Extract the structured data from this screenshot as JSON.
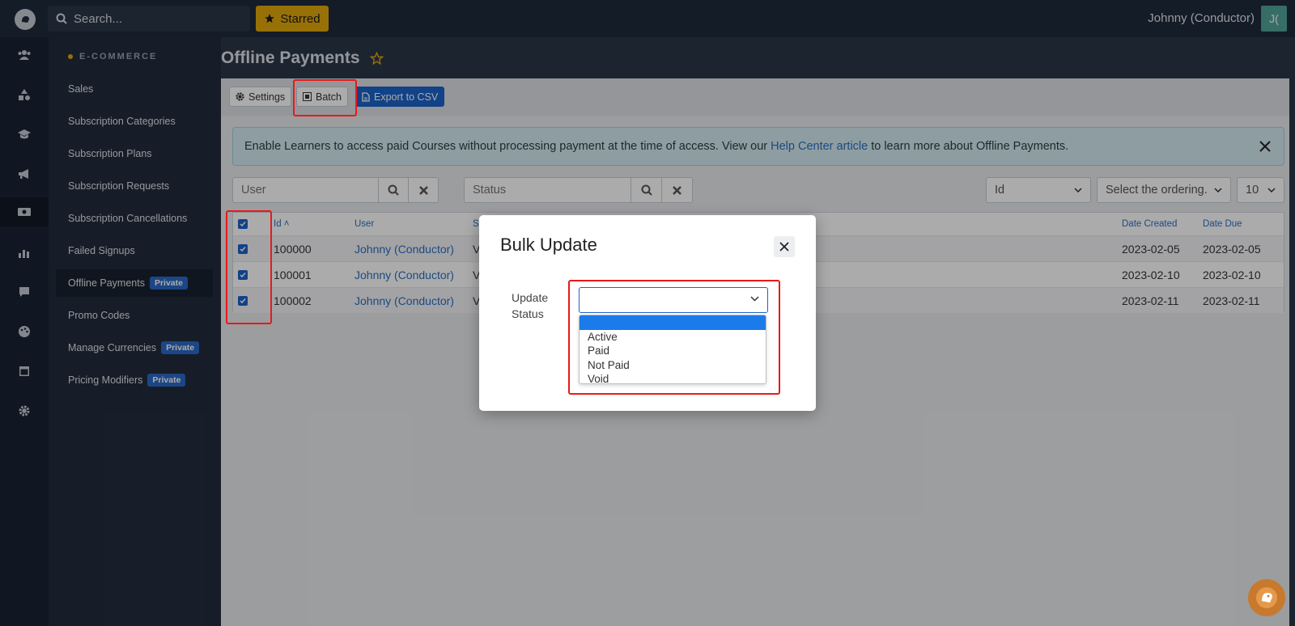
{
  "topbar": {
    "search_placeholder": "Search...",
    "starred_label": "Starred",
    "user_name": "Johnny (Conductor)",
    "avatar_initials": "J("
  },
  "rail_icons": [
    "users-icon",
    "shapes-icon",
    "graduation-cap-icon",
    "megaphone-icon",
    "money-icon",
    "chart-icon",
    "chat-icon",
    "palette-icon",
    "window-icon",
    "gear-icon"
  ],
  "nav": {
    "section": "E-COMMERCE",
    "items": [
      {
        "label": "Sales"
      },
      {
        "label": "Subscription Categories"
      },
      {
        "label": "Subscription Plans"
      },
      {
        "label": "Subscription Requests"
      },
      {
        "label": "Subscription Cancellations"
      },
      {
        "label": "Failed Signups"
      },
      {
        "label": "Offline Payments",
        "badge": "Private"
      },
      {
        "label": "Promo Codes"
      },
      {
        "label": "Manage Currencies",
        "badge": "Private"
      },
      {
        "label": "Pricing Modifiers",
        "badge": "Private"
      }
    ]
  },
  "page": {
    "title": "Offline Payments",
    "toolbar": {
      "settings": "Settings",
      "batch": "Batch",
      "export": "Export to CSV"
    },
    "alert": {
      "text_before": "Enable Learners to access paid Courses without processing payment at the time of access. View our",
      "link": "Help Center article",
      "text_after": "to learn more about Offline Payments."
    },
    "filters": {
      "user_placeholder": "User",
      "status_placeholder": "Status",
      "sort_field": "Id",
      "ordering_placeholder": "Select the ordering.",
      "page_size": "10"
    },
    "table": {
      "headers": {
        "id": "Id ˄",
        "user": "User",
        "status": "St",
        "date_created": "Date Created",
        "date_due": "Date Due"
      },
      "rows": [
        {
          "id": "100000",
          "user": "Johnny (Conductor)",
          "status": "V",
          "date_created": "2023-02-05",
          "date_due": "2023-02-05"
        },
        {
          "id": "100001",
          "user": "Johnny (Conductor)",
          "status": "V",
          "date_created": "2023-02-10",
          "date_due": "2023-02-10"
        },
        {
          "id": "100002",
          "user": "Johnny (Conductor)",
          "status": "V",
          "date_created": "2023-02-11",
          "date_due": "2023-02-11"
        }
      ]
    }
  },
  "modal": {
    "title": "Bulk Update",
    "label_line1": "Update",
    "label_line2": "Status",
    "selected_value": "",
    "options": [
      "",
      "Active",
      "Paid",
      "Not Paid",
      "Void"
    ]
  },
  "colors": {
    "accent": "#1c63c9",
    "starred": "#e1a90c",
    "highlight": "#e81a1a",
    "success": "#1e8b4d"
  }
}
